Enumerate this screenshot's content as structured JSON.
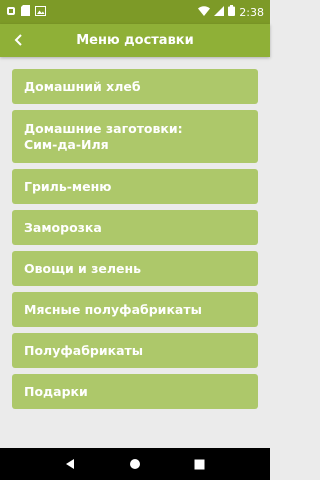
{
  "status_bar": {
    "time": "2:38",
    "icons": [
      "notification-app-icon",
      "notification-sd-icon",
      "notification-image-icon",
      "wifi-icon",
      "signal-icon",
      "battery-icon"
    ]
  },
  "app_bar": {
    "title": "Меню доставки",
    "back_icon": "chevron-left-icon"
  },
  "menu": {
    "items": [
      {
        "label": "Домашний хлеб"
      },
      {
        "label": "Домашние заготовки:\nСим-да-Иля"
      },
      {
        "label": "Гриль-меню"
      },
      {
        "label": "Заморозка"
      },
      {
        "label": "Овощи и зелень"
      },
      {
        "label": "Мясные полуфабрикаты"
      },
      {
        "label": "Полуфабрикаты"
      },
      {
        "label": "Подарки"
      }
    ]
  },
  "nav_bar": {
    "buttons": [
      "back-triangle-icon",
      "home-circle-icon",
      "recents-square-icon"
    ]
  },
  "colors": {
    "status_bar": "#7d9a27",
    "app_bar": "#8fb037",
    "menu_item": "#adc86a",
    "background": "#ebebeb"
  }
}
